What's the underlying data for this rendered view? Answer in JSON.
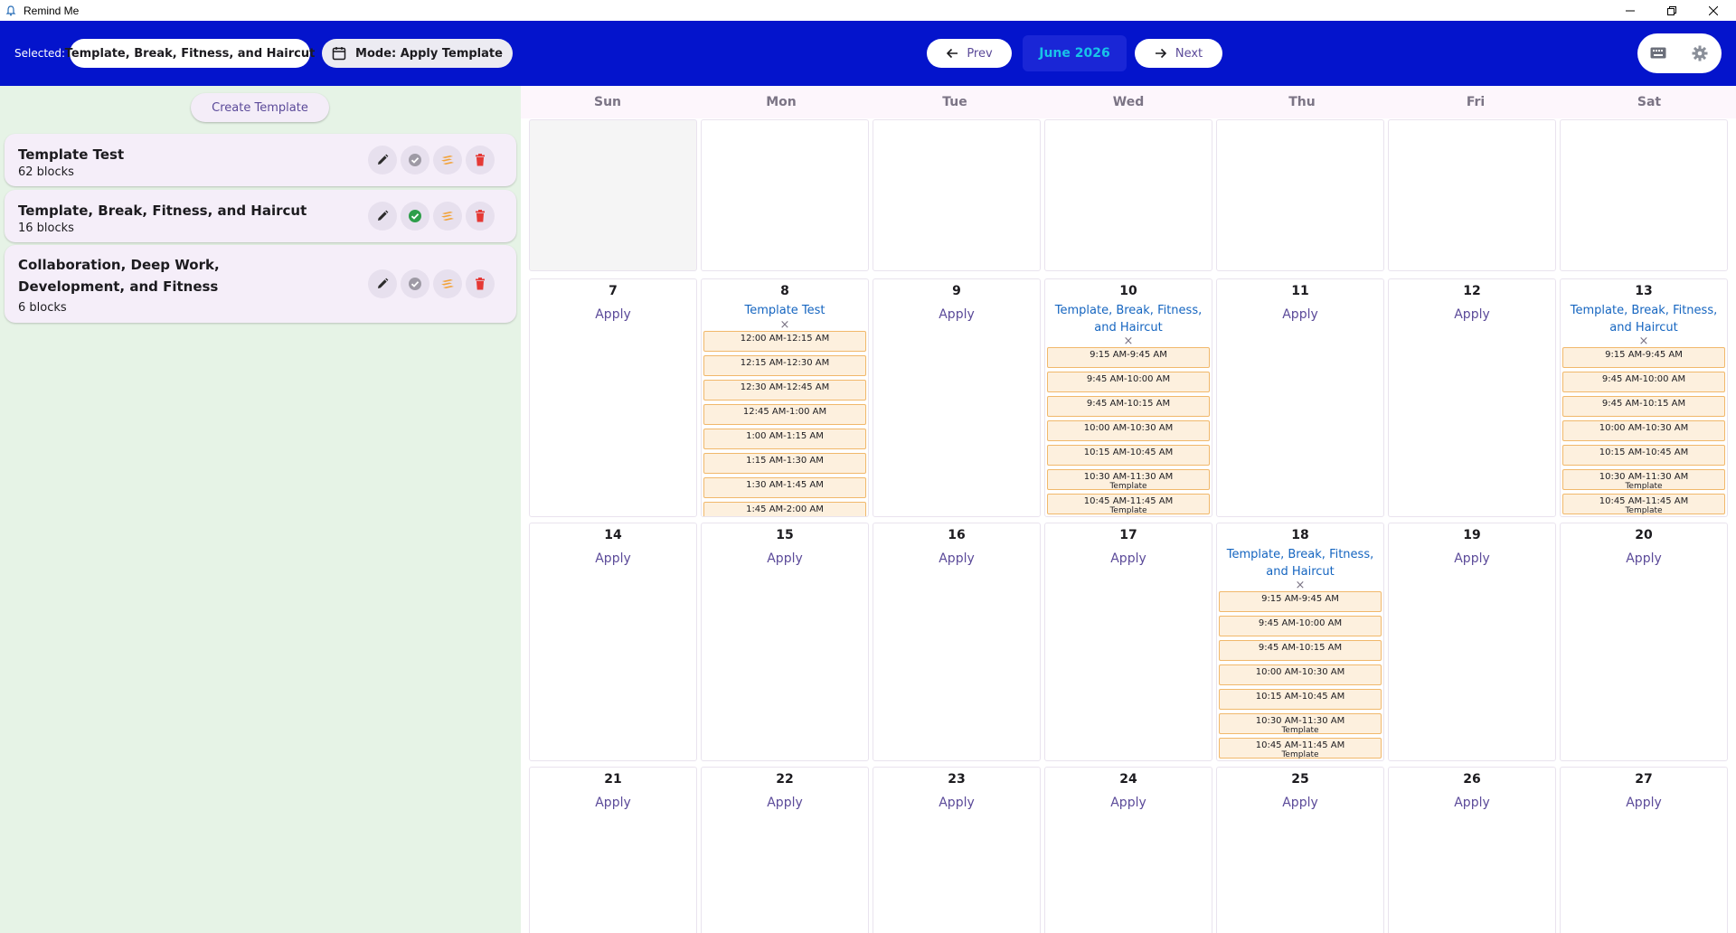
{
  "window": {
    "title": "Remind Me"
  },
  "appbar": {
    "selected_label": "Selected:",
    "selected_template": "Template, Break, Fitness, and Haircut",
    "mode_label": "Mode: Apply Template",
    "prev_label": "Prev",
    "next_label": "Next",
    "month_label": "June 2026"
  },
  "sidebar": {
    "create_label": "Create Template",
    "templates": [
      {
        "name": "Template Test",
        "count": "62 blocks",
        "selected": false
      },
      {
        "name": "Template, Break, Fitness, and Haircut",
        "count": "16 blocks",
        "selected": true
      },
      {
        "name": "Collaboration, Deep Work, Development, and Fitness",
        "count": "6 blocks",
        "selected": false
      }
    ]
  },
  "calendar": {
    "weekdays": [
      "Sun",
      "Mon",
      "Tue",
      "Wed",
      "Thu",
      "Fri",
      "Sat"
    ],
    "apply_label": "Apply",
    "remove_symbol": "×",
    "days": [
      {
        "day": "",
        "disabled": true
      },
      {
        "day": ""
      },
      {
        "day": ""
      },
      {
        "day": ""
      },
      {
        "day": ""
      },
      {
        "day": ""
      },
      {
        "day": ""
      },
      {
        "day": "7"
      },
      {
        "day": "8",
        "template": "Template Test",
        "blocks": [
          {
            "time": "12:00 AM-12:15 AM"
          },
          {
            "time": "12:15 AM-12:30 AM"
          },
          {
            "time": "12:30 AM-12:45 AM"
          },
          {
            "time": "12:45 AM-1:00 AM"
          },
          {
            "time": "1:00 AM-1:15 AM"
          },
          {
            "time": "1:15 AM-1:30 AM"
          },
          {
            "time": "1:30 AM-1:45 AM"
          },
          {
            "time": "1:45 AM-2:00 AM"
          }
        ]
      },
      {
        "day": "9"
      },
      {
        "day": "10",
        "template": "Template, Break, Fitness, and Haircut",
        "blocks": [
          {
            "time": "9:15 AM-9:45 AM"
          },
          {
            "time": "9:45 AM-10:00 AM"
          },
          {
            "time": "9:45 AM-10:15 AM"
          },
          {
            "time": "10:00 AM-10:30 AM"
          },
          {
            "time": "10:15 AM-10:45 AM"
          },
          {
            "time": "10:30 AM-11:30 AM",
            "label": "Template"
          },
          {
            "time": "10:45 AM-11:45 AM",
            "label": "Template"
          }
        ]
      },
      {
        "day": "11"
      },
      {
        "day": "12"
      },
      {
        "day": "13",
        "template": "Template, Break, Fitness, and Haircut",
        "blocks": [
          {
            "time": "9:15 AM-9:45 AM"
          },
          {
            "time": "9:45 AM-10:00 AM"
          },
          {
            "time": "9:45 AM-10:15 AM"
          },
          {
            "time": "10:00 AM-10:30 AM"
          },
          {
            "time": "10:15 AM-10:45 AM"
          },
          {
            "time": "10:30 AM-11:30 AM",
            "label": "Template"
          },
          {
            "time": "10:45 AM-11:45 AM",
            "label": "Template"
          }
        ]
      },
      {
        "day": "14"
      },
      {
        "day": "15"
      },
      {
        "day": "16"
      },
      {
        "day": "17"
      },
      {
        "day": "18",
        "template": "Template, Break, Fitness, and Haircut",
        "blocks": [
          {
            "time": "9:15 AM-9:45 AM"
          },
          {
            "time": "9:45 AM-10:00 AM"
          },
          {
            "time": "9:45 AM-10:15 AM"
          },
          {
            "time": "10:00 AM-10:30 AM"
          },
          {
            "time": "10:15 AM-10:45 AM"
          },
          {
            "time": "10:30 AM-11:30 AM",
            "label": "Template"
          },
          {
            "time": "10:45 AM-11:45 AM",
            "label": "Template"
          }
        ]
      },
      {
        "day": "19"
      },
      {
        "day": "20"
      },
      {
        "day": "21"
      },
      {
        "day": "22"
      },
      {
        "day": "23"
      },
      {
        "day": "24"
      },
      {
        "day": "25"
      },
      {
        "day": "26"
      },
      {
        "day": "27"
      }
    ]
  },
  "colors": {
    "appbar": "#0414cc",
    "sidebar_bg": "#e6f3e6",
    "accent_purple": "#5b4a99",
    "template_link": "#1565c0",
    "block_fill": "#fdf0de",
    "block_border": "#f1b86b",
    "selected_check": "#2e9e4a",
    "delete_red": "#e53935"
  },
  "icons": {
    "app": "app-bell-icon",
    "mode": "calendar-icon",
    "prev": "arrow-left-icon",
    "next": "arrow-right-icon",
    "keyboard": "keyboard-icon",
    "settings": "gear-icon",
    "edit": "pencil-icon",
    "select": "check-circle-icon",
    "apply": "layers-icon",
    "delete": "trash-icon"
  }
}
